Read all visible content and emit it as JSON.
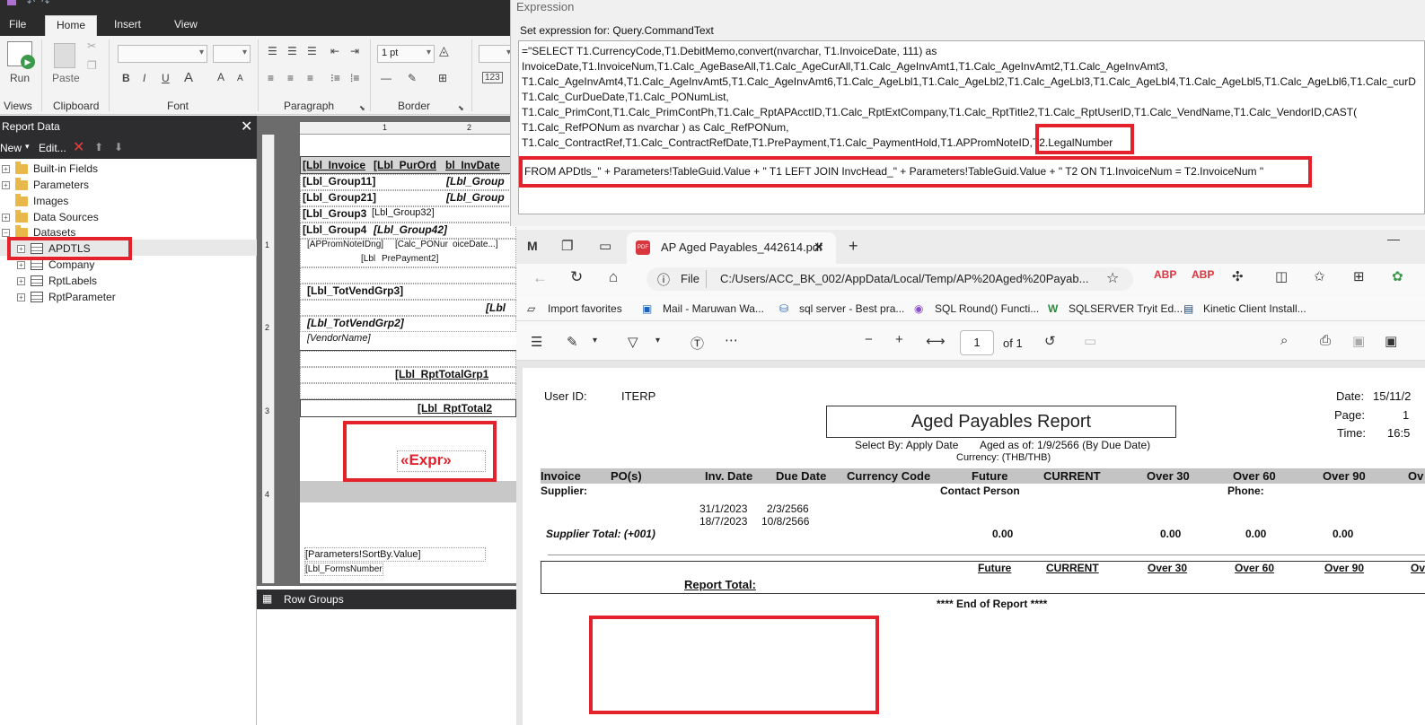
{
  "ribbon": {
    "tabs": [
      "File",
      "Home",
      "Insert",
      "View"
    ],
    "groups": {
      "views": "Views",
      "clipboard": "Clipboard",
      "font": "Font",
      "paragraph": "Paragraph",
      "border": "Border"
    },
    "run_label": "Run",
    "paste_label": "Paste",
    "border_width": "1 pt"
  },
  "report_data": {
    "title": "Report Data",
    "toolbar": {
      "new_label": "New",
      "edit_label": "Edit..."
    },
    "items": {
      "builtin": "Built-in Fields",
      "parameters": "Parameters",
      "images": "Images",
      "data_sources": "Data Sources",
      "datasets": "Datasets",
      "apdtls": "APDTLS",
      "company": "Company",
      "rptlabels": "RptLabels",
      "rptparameter": "RptParameter"
    }
  },
  "designer": {
    "cells": {
      "lbl_invoice": "[Lbl_Invoice",
      "lbl_purord": "[Lbl_PurOrd",
      "lbl_invdate": "bl_InvDate",
      "lbl_group11": "[Lbl_Group11]",
      "lbl_group1b": "[Lbl_Group",
      "lbl_group21": "[Lbl_Group21]",
      "lbl_group2b": "[Lbl_Group",
      "lbl_group3": "[Lbl_Group3",
      "lbl_group32": "[Lbl_Group32]",
      "lbl_group4": "[Lbl_Group4",
      "lbl_group42": "[Lbl_Group42]",
      "apromnote": "[APPromNoteIDng]",
      "calc_ponum": "[Calc_PONur",
      "invoicedate": "oiceDate...]",
      "lbl_prefix": "[Lbl",
      "prepayment": "PrePayment2]",
      "tot_vend_grp3": "[Lbl_TotVendGrp3]",
      "lbl_right": "[Lbl",
      "tot_vend_grp2": "[Lbl_TotVendGrp2]",
      "vendor_name": "[VendorName]",
      "rpt_total_grp1": "[Lbl_RptTotalGrp1",
      "rpt_total2": "[Lbl_RptTotal2",
      "expr": "«Expr»",
      "sortby": "[Parameters!SortBy.Value]",
      "forms_number": "[Lbl_FormsNumber"
    },
    "ruler_top": [
      "1",
      "2"
    ],
    "ruler_left": [
      "1",
      "2",
      "3",
      "4"
    ],
    "row_groups": "Row Groups"
  },
  "expression": {
    "title": "Expression",
    "label": "Set expression for: Query.CommandText",
    "lines": [
      "=\"SELECT T1.CurrencyCode,T1.DebitMemo,convert(nvarchar, T1.InvoiceDate, 111) as",
      "InvoiceDate,T1.InvoiceNum,T1.Calc_AgeBaseAll,T1.Calc_AgeCurAll,T1.Calc_AgeInvAmt1,T1.Calc_AgeInvAmt2,T1.Calc_AgeInvAmt3,",
      "T1.Calc_AgeInvAmt4,T1.Calc_AgeInvAmt5,T1.Calc_AgeInvAmt6,T1.Calc_AgeLbl1,T1.Calc_AgeLbl2,T1.Calc_AgeLbl3,T1.Calc_AgeLbl4,T1.Calc_AgeLbl5,T1.Calc_AgeLbl6,T1.Calc_curD",
      "T1.Calc_CurDueDate,T1.Calc_PONumList,",
      "T1.Calc_PrimCont,T1.Calc_PrimContPh,T1.Calc_RptAPAcctID,T1.Calc_RptExtCompany,T1.Calc_RptTitle2,T1.Calc_RptUserID,T1.Calc_VendName,T1.Calc_VendorID,CAST(",
      "T1.Calc_RefPONum as nvarchar ) as Calc_RefPONum,",
      "T1.Calc_ContractRef,T1.Calc_ContractRefDate,T1.PrePayment,T1.Calc_PaymentHold,T1.APPromNoteID,"
    ],
    "highlight": "T2.LegalNumber",
    "from_line": "FROM APDtls_\" + Parameters!TableGuid.Value + \" T1 LEFT JOIN InvcHead_\" + Parameters!TableGuid.Value + \" T2 ON T1.InvoiceNum = T2.InvoiceNum \""
  },
  "browser": {
    "tab_title": "AP Aged Payables_442614.pdf",
    "file_label": "File",
    "url": "C:/Users/ACC_BK_002/AppData/Local/Temp/AP%20Aged%20Payab...",
    "favorites": [
      "Import favorites",
      "Mail - Maruwan Wa...",
      "sql server - Best pra...",
      "SQL Round() Functi...",
      "SQLSERVER Tryit Ed...",
      "Kinetic Client Install..."
    ],
    "page_current": "1",
    "page_total": "of 1"
  },
  "report": {
    "user_label": "User ID:",
    "user_value": "ITERP",
    "date_label": "Date:",
    "date_value": "15/11/2",
    "page_label": "Page:",
    "page_value": "1",
    "time_label": "Time:",
    "time_value": "16:5",
    "title": "Aged Payables Report",
    "select_by": "Select By: Apply Date",
    "aged_as_of": "Aged as of: 1/9/2566 (By Due Date)",
    "currency": "Currency: (THB/THB)",
    "headers": [
      "Invoice",
      "PO(s)",
      "Inv. Date",
      "Due Date",
      "Currency Code",
      "Future",
      "CURRENT",
      "Over 30",
      "Over 60",
      "Over 90",
      "Ov"
    ],
    "supplier_label": "Supplier:",
    "contact_label": "Contact Person",
    "phone_label": "Phone:",
    "rows": [
      {
        "inv_date": "31/1/2023",
        "due_date": "2/3/2566"
      },
      {
        "inv_date": "18/7/2023",
        "due_date": "10/8/2566"
      }
    ],
    "supplier_total_label": "Supplier Total: (+001)",
    "supplier_totals": [
      "0.00",
      "0.00",
      "0.00",
      "0.00"
    ],
    "total_headers": [
      "Future",
      "CURRENT",
      "Over 30",
      "Over 60",
      "Over 90",
      "Ov"
    ],
    "report_total_label": "Report Total:",
    "end_label": "**** End of Report ****"
  }
}
